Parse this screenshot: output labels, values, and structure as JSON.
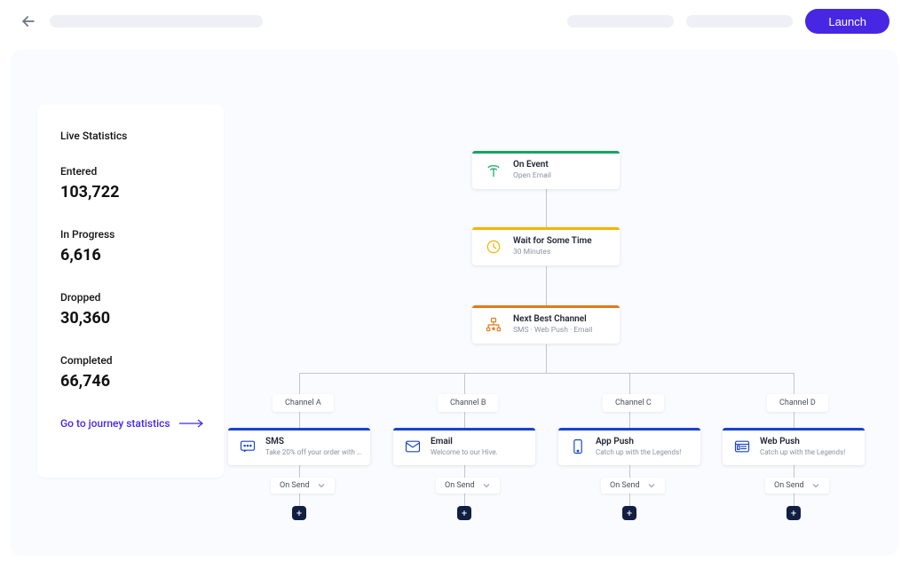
{
  "header": {
    "launch_label": "Launch"
  },
  "stats": {
    "title": "Live Statistics",
    "items": [
      {
        "label": "Entered",
        "value": "103,722"
      },
      {
        "label": "In Progress",
        "value": "6,616"
      },
      {
        "label": "Dropped",
        "value": "30,360"
      },
      {
        "label": "Completed",
        "value": "66,746"
      }
    ],
    "link_label": "Go to journey statistics"
  },
  "flow": {
    "start": {
      "title": "On Event",
      "sub": "Open Email",
      "accent": "#1aa364"
    },
    "wait": {
      "title": "Wait for Some Time",
      "sub": "30 Minutes",
      "accent": "#f4b400"
    },
    "nbc": {
      "title": "Next Best Channel",
      "sub": "SMS · Web Push · Email",
      "accent": "#e07b1a"
    },
    "channel_labels": [
      "Channel A",
      "Channel B",
      "Channel C",
      "Channel D"
    ],
    "channels": [
      {
        "title": "SMS",
        "sub": "Take 20% off your order with code ..."
      },
      {
        "title": "Email",
        "sub": "Welcome to our Hive."
      },
      {
        "title": "App Push",
        "sub": "Catch up with the Legends!"
      },
      {
        "title": "Web Push",
        "sub": "Catch up with the Legends!"
      }
    ],
    "onsend_label": "On Send",
    "add_glyph": "+"
  }
}
